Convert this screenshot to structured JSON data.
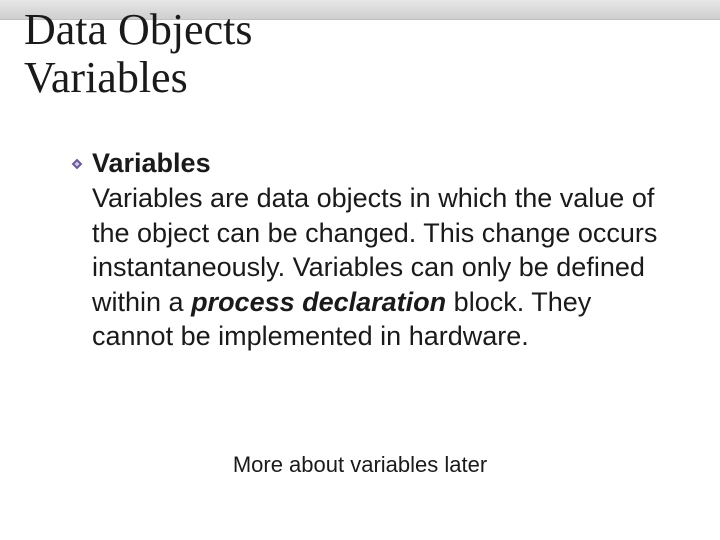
{
  "title": {
    "line1": "Data Objects",
    "line2": "Variables"
  },
  "bullet": {
    "label": "Variables"
  },
  "body": {
    "seg1": " Variables are data objects in which the value of the object can be changed. This change occurs instantaneously. Variables can only be defined within a ",
    "emph": "process declaration",
    "seg2": " block. They cannot be implemented in hardware."
  },
  "footer": "More about variables later"
}
